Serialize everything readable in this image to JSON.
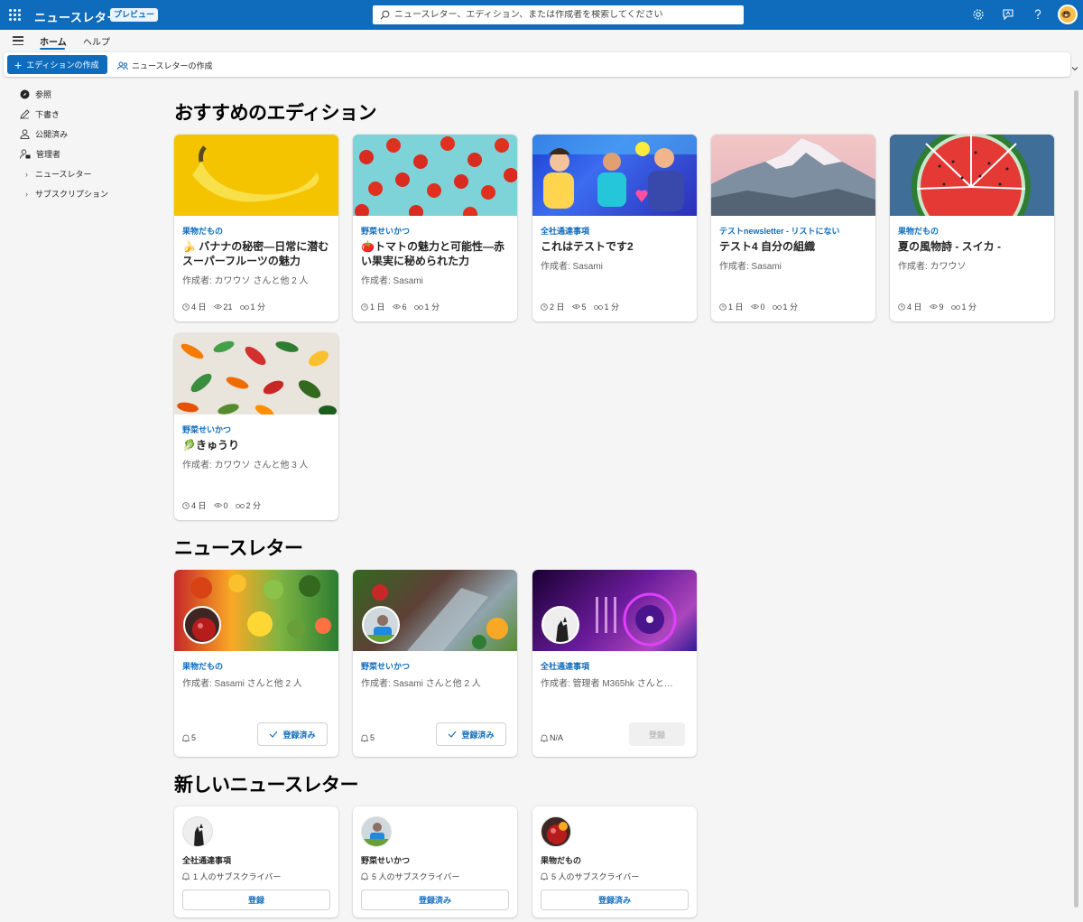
{
  "header": {
    "app_title": "ニュースレター",
    "preview_badge": "プレビュー",
    "search_placeholder": "ニュースレター、エディション、または作成者を検索してください"
  },
  "nav": {
    "tabs": [
      {
        "label": "ホーム",
        "active": true
      },
      {
        "label": "ヘルプ",
        "active": false
      }
    ]
  },
  "commands": {
    "create_edition": "エディションの作成",
    "create_newsletter": "ニュースレターの作成"
  },
  "sidebar": {
    "items": [
      {
        "label": "参照",
        "icon": "compass-icon"
      },
      {
        "label": "下書き",
        "icon": "pencil-icon"
      },
      {
        "label": "公開済み",
        "icon": "person-icon"
      },
      {
        "label": "管理者",
        "icon": "admin-person-icon"
      }
    ],
    "subitems": [
      {
        "label": "ニュースレター"
      },
      {
        "label": "サブスクリプション"
      }
    ]
  },
  "sections": {
    "featured": "おすすめのエディション",
    "newsletters": "ニュースレター",
    "new_newsletters": "新しいニュースレター"
  },
  "featured_editions": [
    {
      "category": "果物だもの",
      "title": "🍌 バナナの秘密―日常に潜むスーパーフルーツの魅力",
      "author": "作成者: カワウソ さんと他 2 人",
      "days": "4 日",
      "views": "21",
      "read_time": "1 分"
    },
    {
      "category": "野菜せいかつ",
      "title": "🍅トマトの魅力と可能性―赤い果実に秘められた力",
      "author": "作成者: Sasami",
      "days": "1 日",
      "views": "6",
      "read_time": "1 分"
    },
    {
      "category": "全社通達事項",
      "title": "これはテストです2",
      "author": "作成者: Sasami",
      "days": "2 日",
      "views": "5",
      "read_time": "1 分"
    },
    {
      "category": "テストnewsletter - リストにない",
      "title": "テスト4 自分の組織",
      "author": "作成者: Sasami",
      "days": "1 日",
      "views": "0",
      "read_time": "1 分"
    },
    {
      "category": "果物だもの",
      "title": "夏の風物詩 - スイカ -",
      "author": "作成者: カワウソ",
      "days": "4 日",
      "views": "9",
      "read_time": "1 分"
    },
    {
      "category": "野菜せいかつ",
      "title": "🥬きゅうり",
      "author": "作成者: カワウソ さんと他 3 人",
      "days": "4 日",
      "views": "0",
      "read_time": "2 分"
    }
  ],
  "newsletters": [
    {
      "category": "果物だもの",
      "author": "作成者: Sasami さんと他 2 人",
      "subscribers": "5",
      "button": "登録済み",
      "subscribed": true
    },
    {
      "category": "野菜せいかつ",
      "author": "作成者: Sasami さんと他 2 人",
      "subscribers": "5",
      "button": "登録済み",
      "subscribed": true
    },
    {
      "category": "全社通達事項",
      "author": "作成者: 管理者 M365hk さんと…",
      "subscribers": "N/A",
      "button": "登録",
      "subscribed": false
    }
  ],
  "new_newsletters": [
    {
      "name": "全社通達事項",
      "subscribers": "1 人のサブスクライバー",
      "button": "登録"
    },
    {
      "name": "野菜せいかつ",
      "subscribers": "5 人のサブスクライバー",
      "button": "登録済み"
    },
    {
      "name": "果物だもの",
      "subscribers": "5 人のサブスクライバー",
      "button": "登録済み"
    }
  ],
  "colors": {
    "brand": "#0f6cbd"
  }
}
